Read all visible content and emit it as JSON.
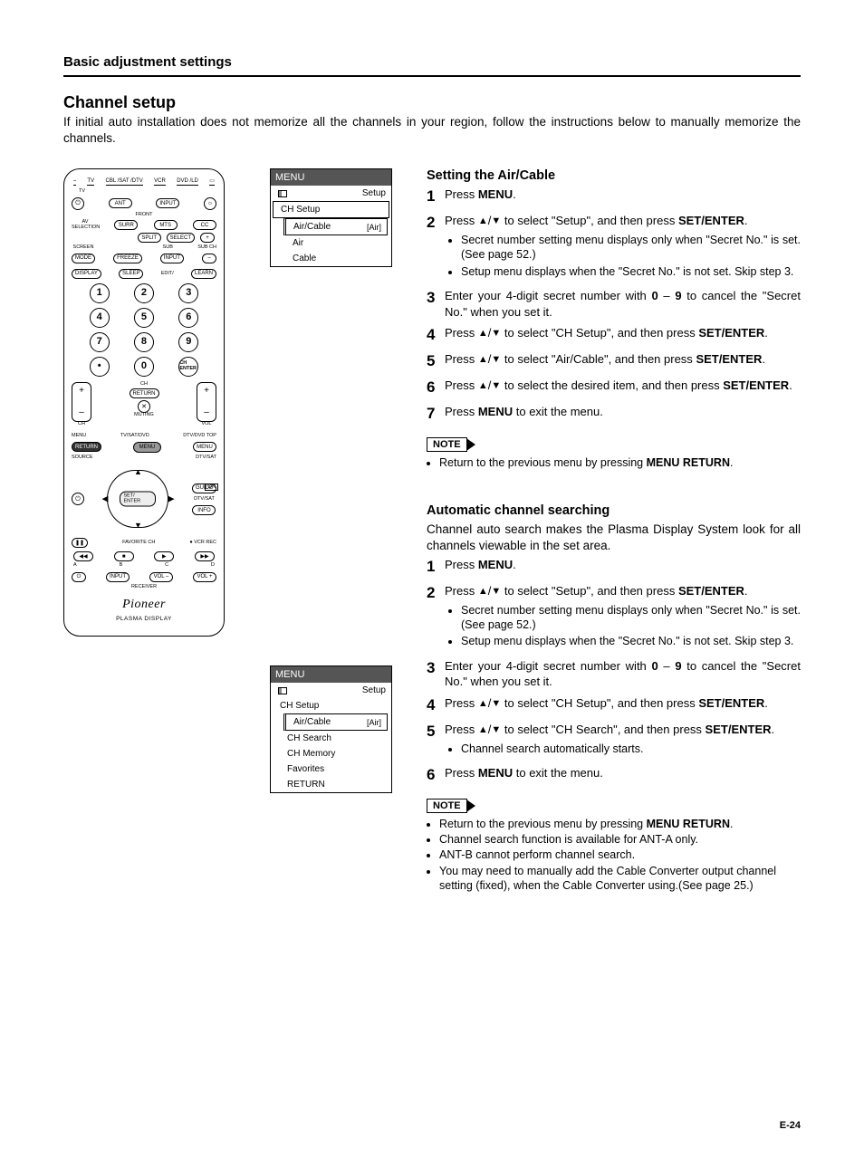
{
  "header": {
    "title": "Basic adjustment settings"
  },
  "section": {
    "title": "Channel setup",
    "intro": "If initial auto installation does not memorize all the channels in your region, follow the instructions below to manually memorize the channels."
  },
  "remote": {
    "top_labels": [
      "TV",
      "TV",
      "CBL /SAT /DTV",
      "VCR",
      "DVD /LD"
    ],
    "row1": {
      "power": "⏻",
      "ant": "ANT",
      "input": "INPUT",
      "bright": "☼",
      "front": "FRONT"
    },
    "row2": {
      "avsel": "AV SELECTION",
      "surr": "SURR",
      "mts": "MTS",
      "cc": "CC"
    },
    "row3": {
      "split": "SPLIT",
      "select": "SELECT",
      "plus": "+"
    },
    "row4": {
      "screen": "SCREEN",
      "mode": "MODE",
      "freeze": "FREEZE",
      "sub": "SUB",
      "input": "INPUT",
      "subch": "SUB CH",
      "minus": "–"
    },
    "row5": {
      "display": "DISPLAY",
      "sleep": "SLEEP",
      "edit": "EDIT/",
      "learn": "LEARN"
    },
    "numbers": [
      "1",
      "2",
      "3",
      "4",
      "5",
      "6",
      "7",
      "8",
      "9",
      "•",
      "0"
    ],
    "chenter": "CH ENTER",
    "chcol": {
      "top": "+",
      "lbl": "CH",
      "bot": "–",
      "side": "CH"
    },
    "volcol": {
      "top": "+",
      "lbl": "VOL",
      "bot": "–"
    },
    "return": "RETURN",
    "mute": "✕",
    "mutelbl": "MUTING",
    "menurow": {
      "l": "MENU",
      "llbl": "RETURN",
      "m": "TV/SAT/DVD",
      "mlbl": "MENU",
      "r": "DTV/DVD TOP",
      "rlbl": "MENU"
    },
    "source": "SOURCE",
    "dtvsat": "DTV/SAT",
    "guide": "GUIDE",
    "info": "INFO",
    "setenter": "SET/ ENTER",
    "dtvsat2": "DTV/SAT",
    "pause": "❚❚",
    "favch": "FAVORITE CH",
    "vcrrec": "VCR REC",
    "trans": [
      "◀◀",
      "■",
      "▶",
      "▶▶"
    ],
    "translbl": [
      "A",
      "B",
      "C",
      "D"
    ],
    "recv": {
      "power": "⏻",
      "input": "INPUT",
      "volm": "VOL –",
      "volp": "VOL +",
      "lbl": "RECEIVER"
    },
    "ok": "OK",
    "brand": "Pioneer",
    "brandsub": "PLASMA DISPLAY"
  },
  "menu1": {
    "title": "MENU",
    "rows": [
      {
        "t": "Setup",
        "icon": true
      },
      {
        "t": "CH Setup",
        "boxed": true
      },
      {
        "t": "Air/Cable",
        "v": "[Air]",
        "boxed": true,
        "inner": true
      },
      {
        "t": "Air",
        "ind": 3
      },
      {
        "t": "Cable",
        "ind": 3
      }
    ]
  },
  "menu2": {
    "title": "MENU",
    "rows": [
      {
        "t": "Setup",
        "icon": true
      },
      {
        "t": "CH Setup",
        "ind": 1
      },
      {
        "t": "Air/Cable",
        "v": "[Air]",
        "boxed": true,
        "inner": true
      },
      {
        "t": "CH Search",
        "ind": 2
      },
      {
        "t": "CH Memory",
        "ind": 2
      },
      {
        "t": "Favorites",
        "ind": 2
      },
      {
        "t": "RETURN",
        "ind": 2
      }
    ]
  },
  "sectA": {
    "title": "Setting the Air/Cable",
    "steps": [
      {
        "n": "1",
        "pre": "Press ",
        "b": "MENU",
        "post": "."
      },
      {
        "n": "2",
        "pre": "Press ",
        "arr": true,
        "mid": " to select \"Setup\", and then press ",
        "b": "SET/ENTER",
        "post": ".",
        "subs": [
          "Secret number setting menu displays only when \"Secret No.\" is set. (See page 52.)",
          "Setup menu displays when the \"Secret No.\" is not set. Skip step 3."
        ]
      },
      {
        "n": "3",
        "pre": "Enter your 4-digit secret number with ",
        "b": "0",
        "mid2": " – ",
        "b2": "9",
        "post": " to cancel the \"Secret No.\" when you set it."
      },
      {
        "n": "4",
        "pre": "Press ",
        "arr": true,
        "mid": " to select \"CH Setup\", and then press ",
        "b": "SET/ENTER",
        "post": "."
      },
      {
        "n": "5",
        "pre": "Press ",
        "arr": true,
        "mid": " to select \"Air/Cable\", and then press ",
        "b": "SET/ENTER",
        "post": "."
      },
      {
        "n": "6",
        "pre": "Press ",
        "arr": true,
        "mid": " to select the desired item, and then press ",
        "b": "SET/ENTER",
        "post": "."
      },
      {
        "n": "7",
        "pre": "Press ",
        "b": "MENU",
        "post": " to exit the menu."
      }
    ],
    "note_label": "NOTE",
    "notes": [
      {
        "pre": "Return to the previous menu by pressing ",
        "b": "MENU RETURN",
        "post": "."
      }
    ]
  },
  "sectB": {
    "title": "Automatic channel searching",
    "intro": "Channel auto search makes the Plasma Display System look for all channels viewable in the set area.",
    "steps": [
      {
        "n": "1",
        "pre": "Press ",
        "b": "MENU",
        "post": "."
      },
      {
        "n": "2",
        "pre": "Press ",
        "arr": true,
        "mid": " to select \"Setup\", and then press ",
        "b": "SET/ENTER",
        "post": ".",
        "subs": [
          "Secret number setting menu displays only when \"Secret No.\" is set. (See page 52.)",
          "Setup menu displays when the \"Secret No.\" is not set. Skip step 3."
        ]
      },
      {
        "n": "3",
        "pre": "Enter your 4-digit secret number with ",
        "b": "0",
        "mid2": " – ",
        "b2": "9",
        "post": " to cancel the \"Secret No.\" when you set it."
      },
      {
        "n": "4",
        "pre": "Press ",
        "arr": true,
        "mid": " to select \"CH Setup\", and then press ",
        "b": "SET/ENTER",
        "post": "."
      },
      {
        "n": "5",
        "pre": "Press ",
        "arr": true,
        "mid": " to select \"CH Search\", and then press ",
        "b": "SET/ENTER",
        "post": ".",
        "subs": [
          "Channel search automatically starts."
        ]
      },
      {
        "n": "6",
        "pre": "Press ",
        "b": "MENU",
        "post": " to exit the menu."
      }
    ],
    "note_label": "NOTE",
    "notes": [
      {
        "pre": "Return to the previous menu by pressing ",
        "b": "MENU RETURN",
        "post": "."
      },
      {
        "pre": "Channel search function is available for ANT-A only."
      },
      {
        "pre": "ANT-B cannot perform channel search."
      },
      {
        "pre": "You may need to manually add the Cable Converter output channel setting (fixed), when the Cable Converter using.(See page 25.)"
      }
    ]
  },
  "page": "E-24"
}
